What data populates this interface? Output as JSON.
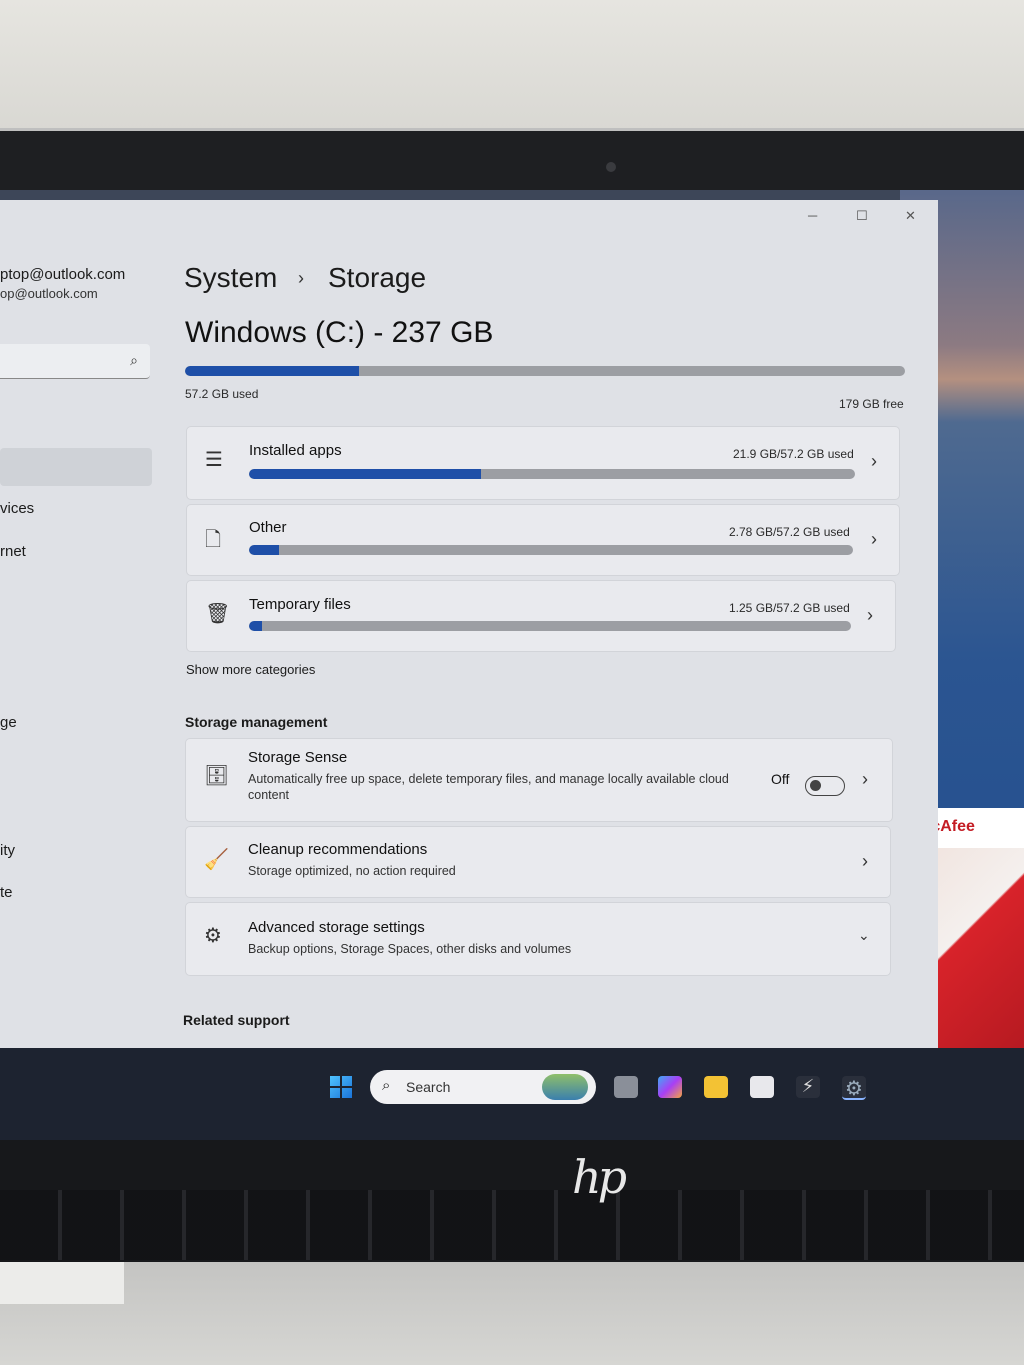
{
  "account": {
    "name": "ptop@outlook.com",
    "email": "op@outlook.com"
  },
  "sidebar": {
    "items": [
      {
        "label": "vices"
      },
      {
        "label": "rnet"
      },
      {
        "label": "ge"
      },
      {
        "label": "ity"
      },
      {
        "label": "te"
      }
    ]
  },
  "window_controls": {
    "minimize": "─",
    "maximize": "☐",
    "close": "✕"
  },
  "breadcrumb": {
    "parent": "System",
    "separator": "›",
    "current": "Storage"
  },
  "drive": {
    "title": "Windows (C:) - 237 GB",
    "used_label": "57.2 GB used",
    "free_label": "179 GB free",
    "used_fraction": 0.241
  },
  "categories": [
    {
      "label": "Installed apps",
      "usage": "21.9 GB/57.2 GB used",
      "fraction": 0.383,
      "icon": "list-icon"
    },
    {
      "label": "Other",
      "usage": "2.78 GB/57.2 GB used",
      "fraction": 0.049,
      "icon": "document-icon"
    },
    {
      "label": "Temporary files",
      "usage": "1.25 GB/57.2 GB used",
      "fraction": 0.022,
      "icon": "trash-icon"
    }
  ],
  "show_more": "Show more categories",
  "storage_management": {
    "heading": "Storage management",
    "storage_sense": {
      "title": "Storage Sense",
      "description": "Automatically free up space, delete temporary files, and manage locally available cloud content",
      "state": "Off"
    },
    "cleanup": {
      "title": "Cleanup recommendations",
      "description": "Storage optimized, no action required"
    },
    "advanced": {
      "title": "Advanced storage settings",
      "description": "Backup options, Storage Spaces, other disks and volumes"
    }
  },
  "related_support": "Related support",
  "taskbar": {
    "search_label": "Search"
  },
  "ad": {
    "brand": "McAfee"
  },
  "colors": {
    "accent": "#1e4fa8",
    "bar_track": "#9c9ea3",
    "window_bg": "#dfe1e6"
  }
}
